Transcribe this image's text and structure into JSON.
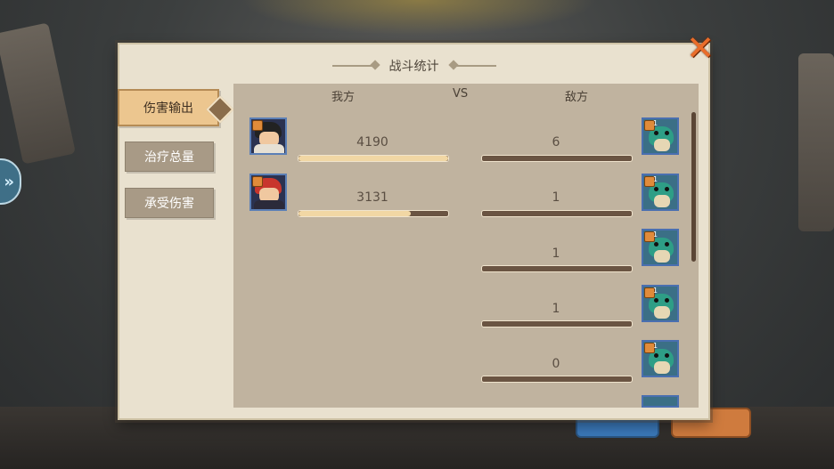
{
  "title": "战斗统计",
  "tabs": [
    {
      "label": "伤害输出",
      "active": true
    },
    {
      "label": "治疗总量",
      "active": false
    },
    {
      "label": "承受伤害",
      "active": false
    }
  ],
  "headers": {
    "ally": "我方",
    "vs": "VS",
    "enemy": "敌方"
  },
  "allies": [
    {
      "value": "4190",
      "fill": 1.0
    },
    {
      "value": "3131",
      "fill": 0.75
    }
  ],
  "enemies": [
    {
      "value": "6",
      "level": "1"
    },
    {
      "value": "1",
      "level": "1"
    },
    {
      "value": "1",
      "level": "1"
    },
    {
      "value": "1",
      "level": "1"
    },
    {
      "value": "0",
      "level": "1"
    }
  ],
  "icons": {
    "close": "close-icon",
    "side": "double-chevron-right-icon"
  },
  "colors": {
    "accent": "#ea6d2a",
    "panel": "#e9e1cf",
    "statsBg": "#c0b39f"
  }
}
